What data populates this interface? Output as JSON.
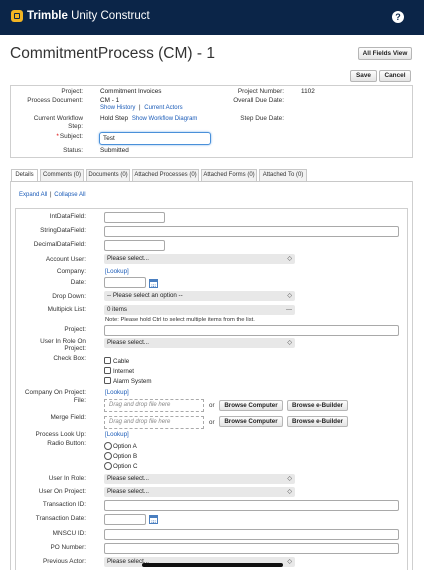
{
  "header": {
    "brand_bold": "Trimble",
    "brand_rest": " Unity Construct",
    "help_label": "?"
  },
  "page": {
    "title": "CommitmentProcess (CM) - 1",
    "all_fields_label": "All Fields View",
    "save_label": "Save",
    "cancel_label": "Cancel"
  },
  "summary": {
    "project_label": "Project:",
    "project_value": "Commitment Invoices",
    "process_document_label": "Process Document:",
    "process_document_value": "CM - 1",
    "show_history": "Show History",
    "separator": "|",
    "current_actors": "Current Actors",
    "current_workflow_label_1": "Current Workflow",
    "current_workflow_label_2": "Step:",
    "current_workflow_value": "Hold Step",
    "show_workflow_diagram": "Show Workflow Diagram",
    "required_mark": "*",
    "subject_label": "Subject:",
    "subject_value": "Test",
    "status_label": "Status:",
    "status_value": "Submitted",
    "project_number_label": "Project Number:",
    "project_number_value": "1102",
    "overall_due_date_label": "Overall Due Date:",
    "step_due_date_label": "Step Due Date:"
  },
  "tabs": [
    {
      "label": "Details"
    },
    {
      "label": "Comments (0)"
    },
    {
      "label": "Documents (0)"
    },
    {
      "label": "Attached Processes (0)"
    },
    {
      "label": "Attached Forms (0)"
    },
    {
      "label": "Attached To (0)"
    }
  ],
  "links": {
    "expand_all": "Expand All",
    "collapse_sep": "|",
    "collapse_all": "Collapse All"
  },
  "form": {
    "int_label": "IntDataField:",
    "string_label": "StringDataField:",
    "decimal_label": "DecimalDataField:",
    "account_user_label": "Account User:",
    "please_select": "Please select...",
    "company_label": "Company:",
    "lookup": "[Lookup]",
    "date_label": "Date:",
    "drop_down_label": "Drop Down:",
    "select_option": "-- Please select an option --",
    "multipick_label": "Multipick List:",
    "multipick_value": "0 items",
    "multipick_dash": "---",
    "multipick_note": "Note: Please hold Ctrl to select multiple items from the list.",
    "project_label": "Project:",
    "user_in_role_on_project_label_1": "User In Role On",
    "user_in_role_on_project_label_2": "Project:",
    "checkbox_label": "Check Box:",
    "checkbox_options": [
      "Cable",
      "Internet",
      "Alarm System"
    ],
    "company_on_project_label": "Company On Project:",
    "file_label": "File:",
    "drop_placeholder": "Drag and drop file here",
    "or_text": "or",
    "browse_computer": "Browse Computer",
    "browse_ebuilder": "Browse e-Builder",
    "merge_field_label": "Merge Field:",
    "process_lookup_label": "Process Look Up:",
    "radio_label": "Radio Button:",
    "radio_options": [
      "Option A",
      "Option B",
      "Option C"
    ],
    "user_in_role_label": "User In Role:",
    "user_on_project_label": "User On Project:",
    "transaction_id_label": "Transaction ID:",
    "transaction_date_label": "Transaction Date:",
    "mnscu_id_label": "MNSCU ID:",
    "po_number_label": "PO Number:",
    "previous_actor_label": "Previous Actor:",
    "chevron": "◇"
  }
}
